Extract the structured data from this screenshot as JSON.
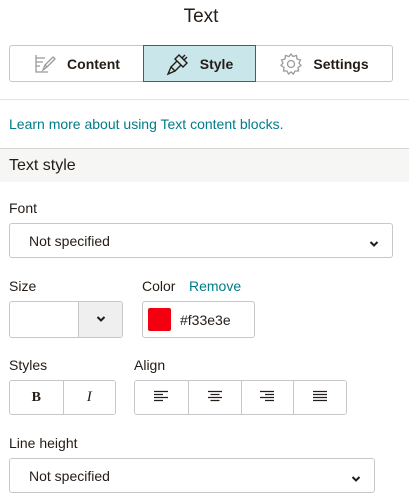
{
  "panel": {
    "title": "Text"
  },
  "tabs": [
    {
      "label": "Content",
      "icon": "pencil-edit-icon",
      "active": false
    },
    {
      "label": "Style",
      "icon": "paint-brush-icon",
      "active": true
    },
    {
      "label": "Settings",
      "icon": "gear-icon",
      "active": false
    }
  ],
  "learn_link": "Learn more about using Text content blocks.",
  "section": {
    "title": "Text style"
  },
  "font": {
    "label": "Font",
    "value": "Not specified"
  },
  "size": {
    "label": "Size",
    "value": ""
  },
  "color": {
    "label": "Color",
    "remove_label": "Remove",
    "hex": "#f33e3e",
    "swatch": "#f30010"
  },
  "styles": {
    "label": "Styles",
    "bold": "B",
    "italic": "I"
  },
  "align": {
    "label": "Align",
    "options": [
      "align-left-icon",
      "align-center-icon",
      "align-right-icon",
      "align-justify-icon"
    ]
  },
  "line_height": {
    "label": "Line height",
    "value": "Not specified"
  },
  "theme": {
    "accent": "#007c89",
    "active_tab_bg": "#c9e6ea",
    "border": "#c7c7c7",
    "section_bg": "#f6f6f4"
  }
}
